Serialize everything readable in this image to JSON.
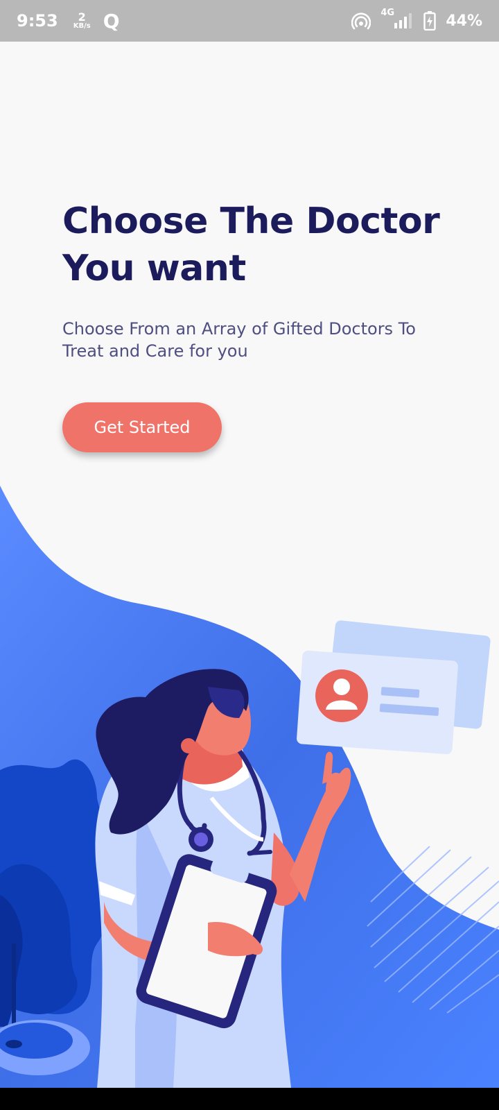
{
  "status_bar": {
    "time": "9:53",
    "speed_value": "2",
    "speed_unit": "KB/s",
    "app_icon_glyph": "Q",
    "network": "4G",
    "battery": "44%"
  },
  "onboarding": {
    "title_line1": "Choose The Doctor",
    "title_line2": "You want",
    "subtitle_line1": "Choose From an Array of Gifted Doctors To",
    "subtitle_line2": "Treat and Care for you",
    "cta_label": "Get Started"
  },
  "colors": {
    "title": "#1c1c5c",
    "subtitle": "#4e4e80",
    "cta": "#f0736a",
    "accent_blue": "#4a7cf5",
    "background": "#f8f8f9"
  },
  "icons": {
    "hotspot": "hotspot-icon",
    "signal": "signal-icon",
    "battery": "battery-charging-icon"
  }
}
